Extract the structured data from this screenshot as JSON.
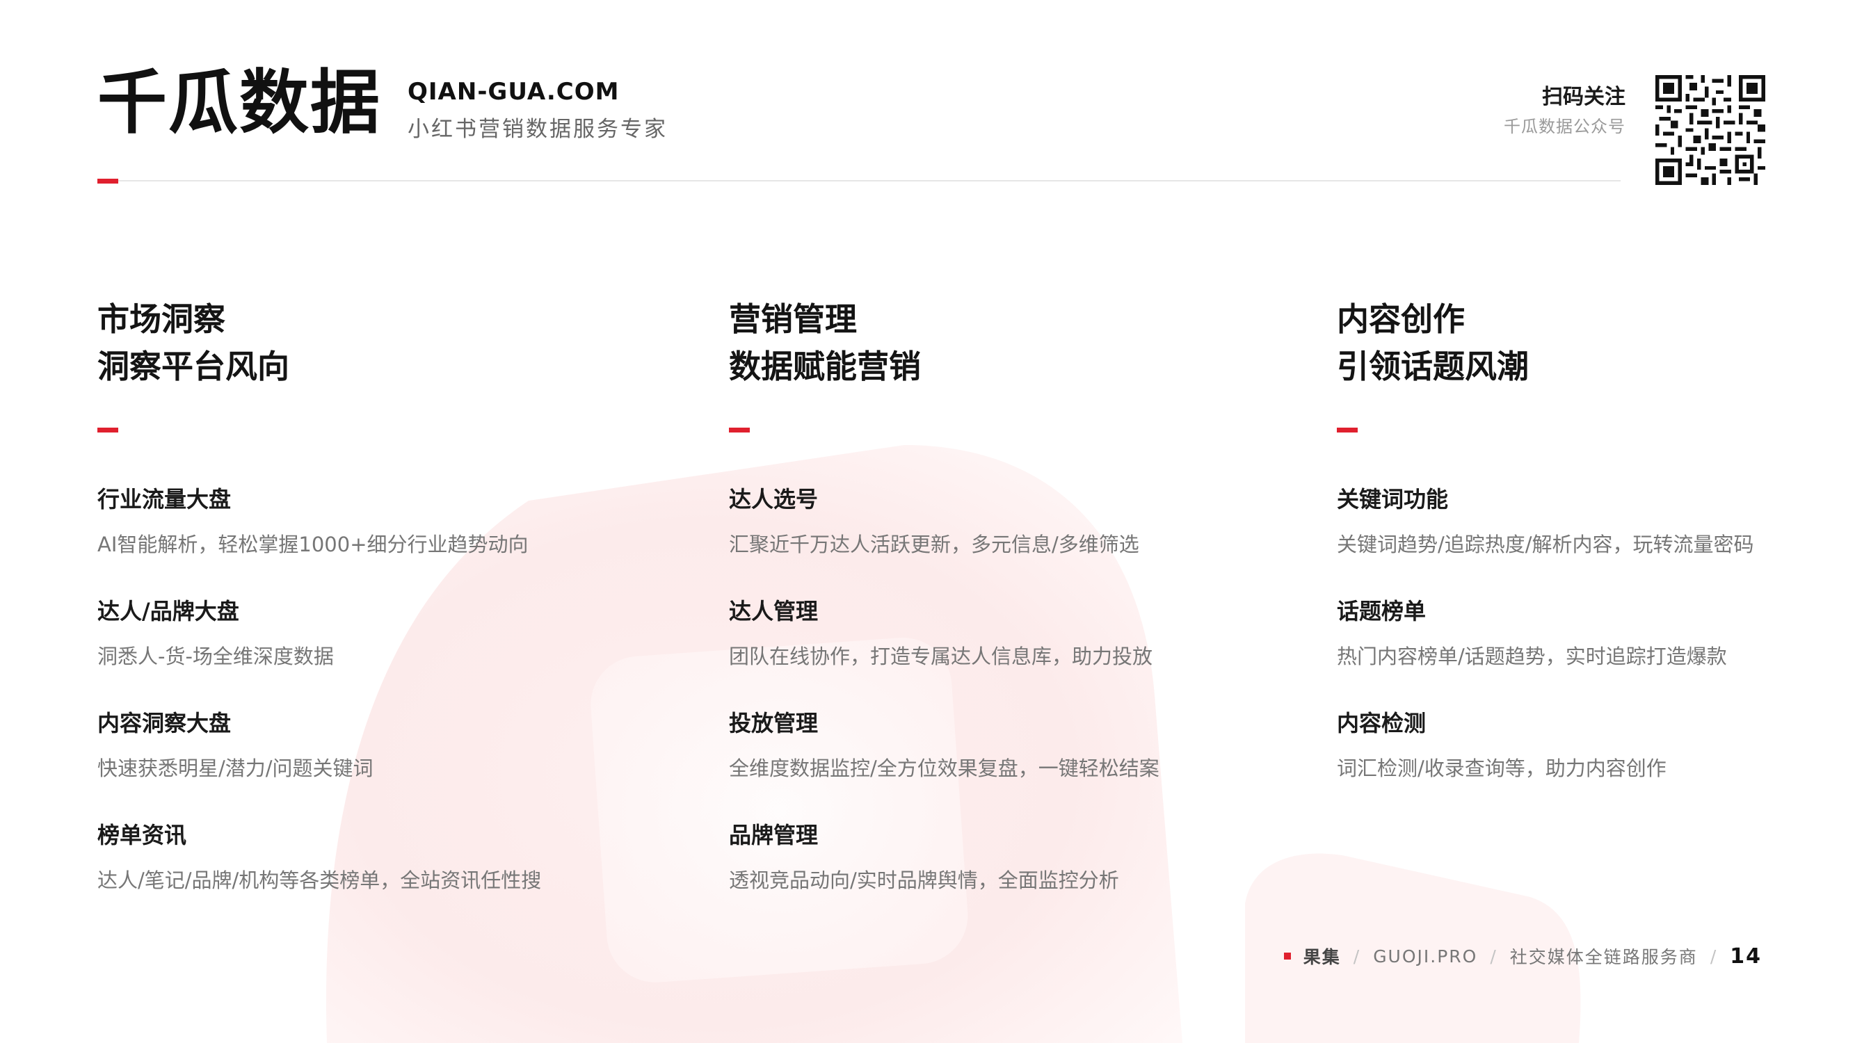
{
  "header": {
    "brand": "千瓜数据",
    "url": "QIAN-GUA.COM",
    "tagline": "小红书营销数据服务专家",
    "follow_title": "扫码关注",
    "follow_subtitle": "千瓜数据公众号"
  },
  "columns": [
    {
      "heading_line1": "市场洞察",
      "heading_line2": "洞察平台风向",
      "items": [
        {
          "title": "行业流量大盘",
          "desc": "AI智能解析，轻松掌握1000+细分行业趋势动向"
        },
        {
          "title": "达人/品牌大盘",
          "desc": "洞悉人-货-场全维深度数据"
        },
        {
          "title": "内容洞察大盘",
          "desc": "快速获悉明星/潜力/问题关键词"
        },
        {
          "title": "榜单资讯",
          "desc": "达人/笔记/品牌/机构等各类榜单，全站资讯任性搜"
        }
      ]
    },
    {
      "heading_line1": "营销管理",
      "heading_line2": "数据赋能营销",
      "items": [
        {
          "title": "达人选号",
          "desc": "汇聚近千万达人活跃更新，多元信息/多维筛选"
        },
        {
          "title": "达人管理",
          "desc": "团队在线协作，打造专属达人信息库，助力投放"
        },
        {
          "title": "投放管理",
          "desc": "全维度数据监控/全方位效果复盘，一键轻松结案"
        },
        {
          "title": "品牌管理",
          "desc": "透视竞品动向/实时品牌舆情，全面监控分析"
        }
      ]
    },
    {
      "heading_line1": "内容创作",
      "heading_line2": "引领话题风潮",
      "items": [
        {
          "title": "关键词功能",
          "desc": "关键词趋势/追踪热度/解析内容，玩转流量密码"
        },
        {
          "title": "话题榜单",
          "desc": "热门内容榜单/话题趋势，实时追踪打造爆款"
        },
        {
          "title": "内容检测",
          "desc": "词汇检测/收录查询等，助力内容创作"
        }
      ]
    }
  ],
  "footer": {
    "brand": "果集",
    "site": "GUOJI.PRO",
    "slogan": "社交媒体全链路服务商",
    "separator": "/",
    "page": "14"
  },
  "colors": {
    "accent": "#e0202e",
    "text": "#1a1a1a",
    "muted": "#767676"
  },
  "icons": [
    "qr-code-icon"
  ]
}
